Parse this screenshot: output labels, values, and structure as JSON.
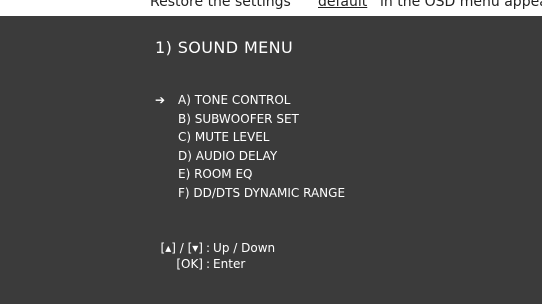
{
  "caption": {
    "prefix": "Restore the settings",
    "underlined": "default",
    "suffix": "in the OSD menu appears:"
  },
  "screen": {
    "title": "1) SOUND MENU",
    "cursor": "➔",
    "menu": [
      {
        "label": "A) TONE CONTROL"
      },
      {
        "label": "B) SUBWOOFER SET"
      },
      {
        "label": "C) MUTE LEVEL"
      },
      {
        "label": "D) AUDIO DELAY"
      },
      {
        "label": "E) ROOM EQ"
      },
      {
        "label": "F) DD/DTS DYNAMIC RANGE"
      }
    ],
    "help": [
      {
        "keys": "[▴] / [▾]",
        "sep": ":",
        "action": "Up / Down"
      },
      {
        "keys": "[OK]",
        "sep": ":",
        "action": "Enter"
      }
    ]
  }
}
